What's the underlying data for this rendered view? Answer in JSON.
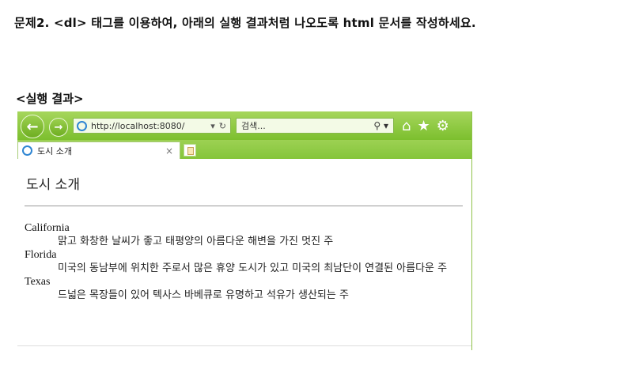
{
  "question": "문제2. <dl> 태그를 이용하여, 아래의 실행 결과처럼 나오도록 html 문서를 작성하세요.",
  "result_label": "<실행 결과>",
  "browser": {
    "address": "http://localhost:8080/",
    "search_placeholder": "검색...",
    "tab_title": "도시 소개",
    "tab_close": "×",
    "back_glyph": "←",
    "forward_glyph": "→",
    "refresh_glyph": "↻",
    "dropdown_glyph": "▾",
    "search_glyph": "⚲ ▾",
    "home_glyph": "⌂",
    "star_glyph": "★",
    "gear_glyph": "⚙",
    "icons": [
      "back-icon",
      "forward-icon",
      "ie-icon",
      "dropdown-icon",
      "refresh-icon",
      "search-icon",
      "home-icon",
      "star-icon",
      "gear-icon",
      "new-tab-icon"
    ],
    "accent_color": "#7cbf2e"
  },
  "page": {
    "heading": "도시 소개",
    "cities": [
      {
        "name": "California",
        "description": "맑고 화창한 날씨가 좋고 태평양의 아름다운 해변을 가진 멋진 주"
      },
      {
        "name": "Florida",
        "description": "미국의 동남부에 위치한 주로서 많은 휴양 도시가 있고 미국의 최남단이 연결된 아름다운 주"
      },
      {
        "name": "Texas",
        "description": "드넓은 목장들이 있어 텍사스 바베큐로 유명하고 석유가 생산되는 주"
      }
    ]
  }
}
